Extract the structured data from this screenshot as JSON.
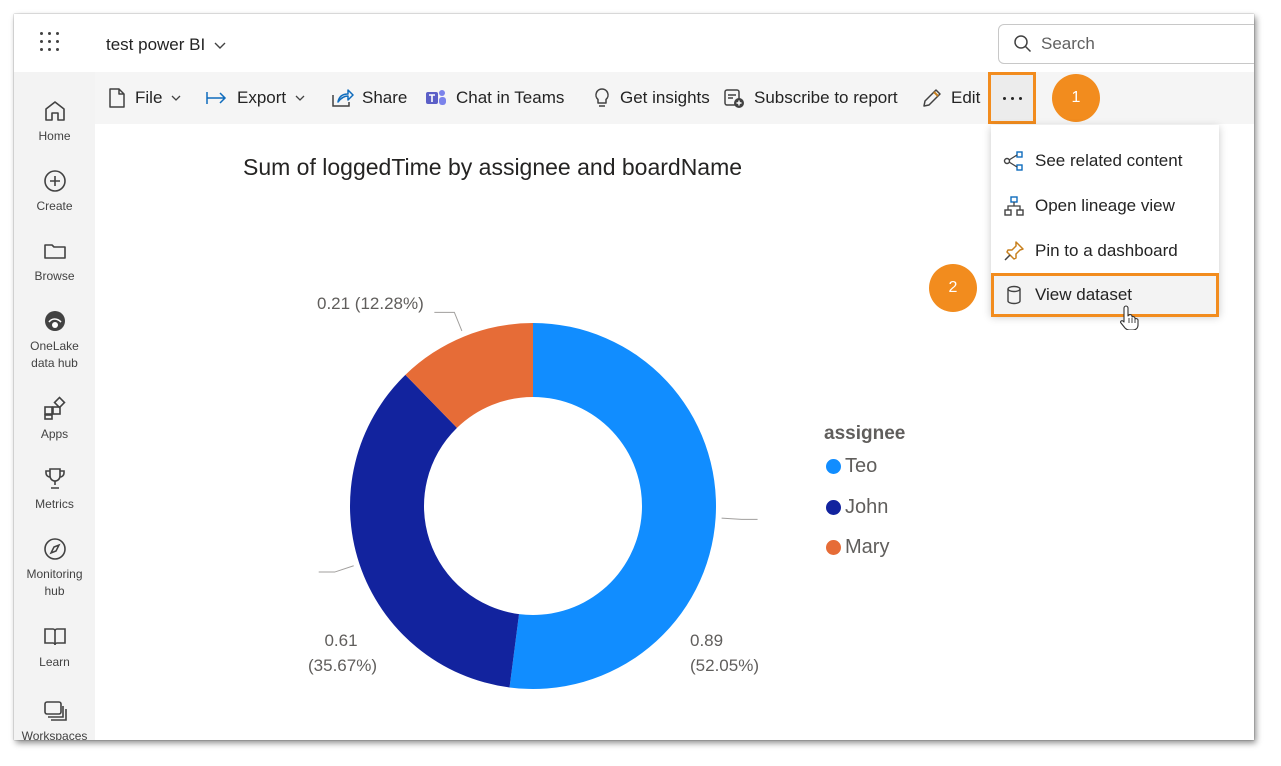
{
  "header": {
    "workspace_title": "test power BI",
    "search_placeholder": "Search"
  },
  "nav": {
    "items": [
      {
        "label": "Home",
        "icon": "home-icon"
      },
      {
        "label": "Create",
        "icon": "plus-circle-icon"
      },
      {
        "label": "Browse",
        "icon": "folder-icon"
      },
      {
        "label": "OneLake data hub",
        "icon": "onelake-icon"
      },
      {
        "label": "Apps",
        "icon": "apps-icon"
      },
      {
        "label": "Metrics",
        "icon": "trophy-icon"
      },
      {
        "label": "Monitoring hub",
        "icon": "compass-icon"
      },
      {
        "label": "Learn",
        "icon": "book-icon"
      },
      {
        "label": "Workspaces",
        "icon": "workspaces-icon"
      }
    ]
  },
  "toolbar": {
    "file": "File",
    "export": "Export",
    "share": "Share",
    "chat_in_teams": "Chat in Teams",
    "get_insights": "Get insights",
    "subscribe": "Subscribe to report",
    "edit": "Edit"
  },
  "dropdown": {
    "items": [
      {
        "label": "See related content",
        "icon": "related-content-icon"
      },
      {
        "label": "Open lineage view",
        "icon": "lineage-icon"
      },
      {
        "label": "Pin to a dashboard",
        "icon": "pin-icon"
      },
      {
        "label": "View dataset",
        "icon": "dataset-icon"
      }
    ]
  },
  "steps": {
    "step1": "1",
    "step2": "2"
  },
  "colors": {
    "accent_orange": "#f28c1e",
    "teo": "#118dff",
    "john": "#12239e",
    "mary": "#e66c37"
  },
  "chart_data": {
    "type": "pie",
    "title": "Sum of loggedTime by assignee and boardName",
    "legend_title": "assignee",
    "legend_position": "right",
    "donut": true,
    "series": [
      {
        "name": "Teo",
        "value": 0.89,
        "percent": "(52.05%)",
        "label_value": "0.89"
      },
      {
        "name": "John",
        "value": 0.61,
        "percent": "(35.67%)",
        "label_value": "0.61"
      },
      {
        "name": "Mary",
        "value": 0.21,
        "percent": "(12.28%)",
        "label_value": "0.21"
      }
    ],
    "labels": {
      "mary": "0.21 (12.28%)"
    }
  }
}
